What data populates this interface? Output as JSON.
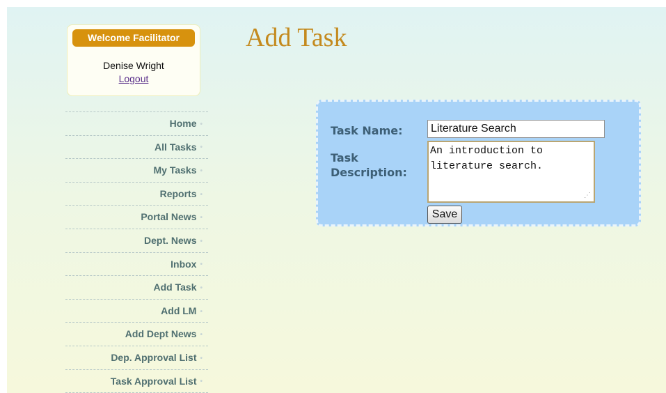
{
  "welcome": {
    "header": "Welcome Facilitator",
    "user_name": "Denise Wright",
    "logout_label": "Logout"
  },
  "nav": {
    "items": [
      {
        "label": "Home"
      },
      {
        "label": "All Tasks"
      },
      {
        "label": "My Tasks"
      },
      {
        "label": "Reports"
      },
      {
        "label": "Portal News"
      },
      {
        "label": "Dept. News"
      },
      {
        "label": "Inbox"
      },
      {
        "label": "Add Task"
      },
      {
        "label": "Add LM"
      },
      {
        "label": "Add Dept News"
      },
      {
        "label": "Dep. Approval List"
      },
      {
        "label": "Task Approval List"
      }
    ]
  },
  "main": {
    "title": "Add Task",
    "form": {
      "task_name_label": "Task Name:",
      "task_name_value": "Literature Search",
      "task_desc_label": "Task Description:",
      "task_desc_value": "An introduction to literature search.",
      "save_label": "Save"
    }
  },
  "colors": {
    "accent": "#d7920e",
    "title": "#c48a1e",
    "panel": "#a9d3f8",
    "nav_text": "#4f6f70"
  },
  "icons": {
    "nav_bullet": "bullet-icon",
    "resize": "resize-grip-icon"
  }
}
